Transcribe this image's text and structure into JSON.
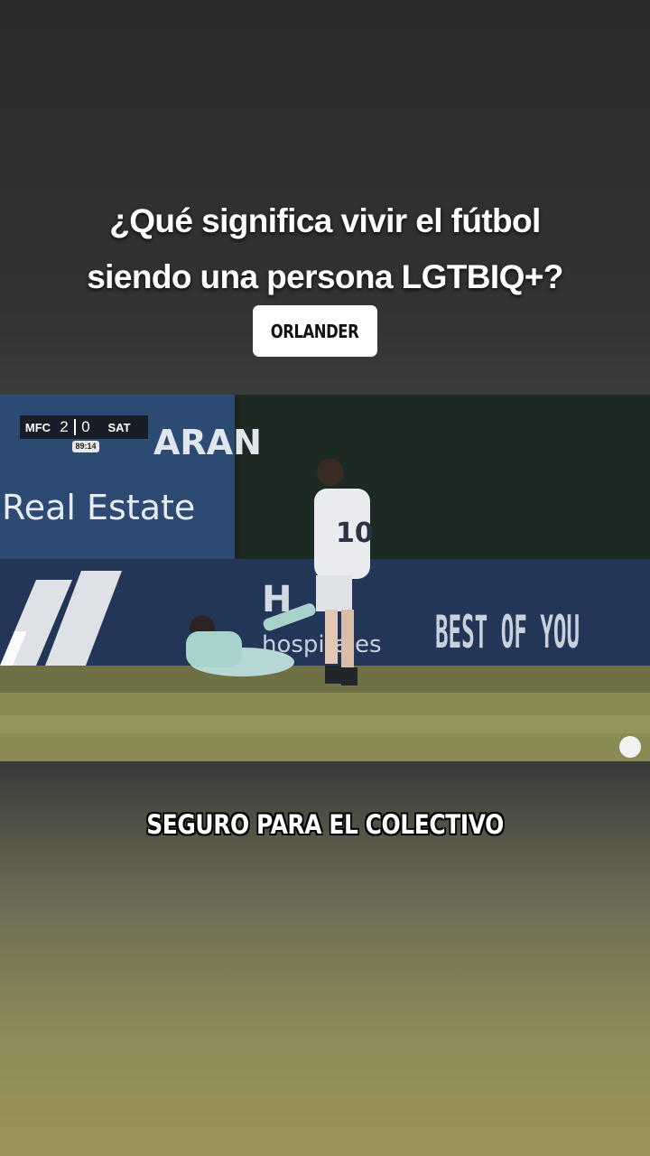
{
  "headline": {
    "line1": "¿Qué significa vivir el fútbol",
    "line2": "siendo una persona LGTBIQ+?"
  },
  "brand": {
    "label": "ORLANDER"
  },
  "video": {
    "banner_text": "Real Estate",
    "banner_fragment": "ARAN",
    "board_text": "BEST OF YOU",
    "jersey_number": "10",
    "scoreboard": {
      "home": "MFC",
      "home_score": "2",
      "away_score": "0",
      "away": "SAT",
      "clock": "89:14"
    }
  },
  "caption": {
    "text": "SEGURO PARA EL COLECTIVO"
  },
  "colors": {
    "pitch": "#8a8a55",
    "banner": "#2c4a72",
    "board": "#233657"
  }
}
